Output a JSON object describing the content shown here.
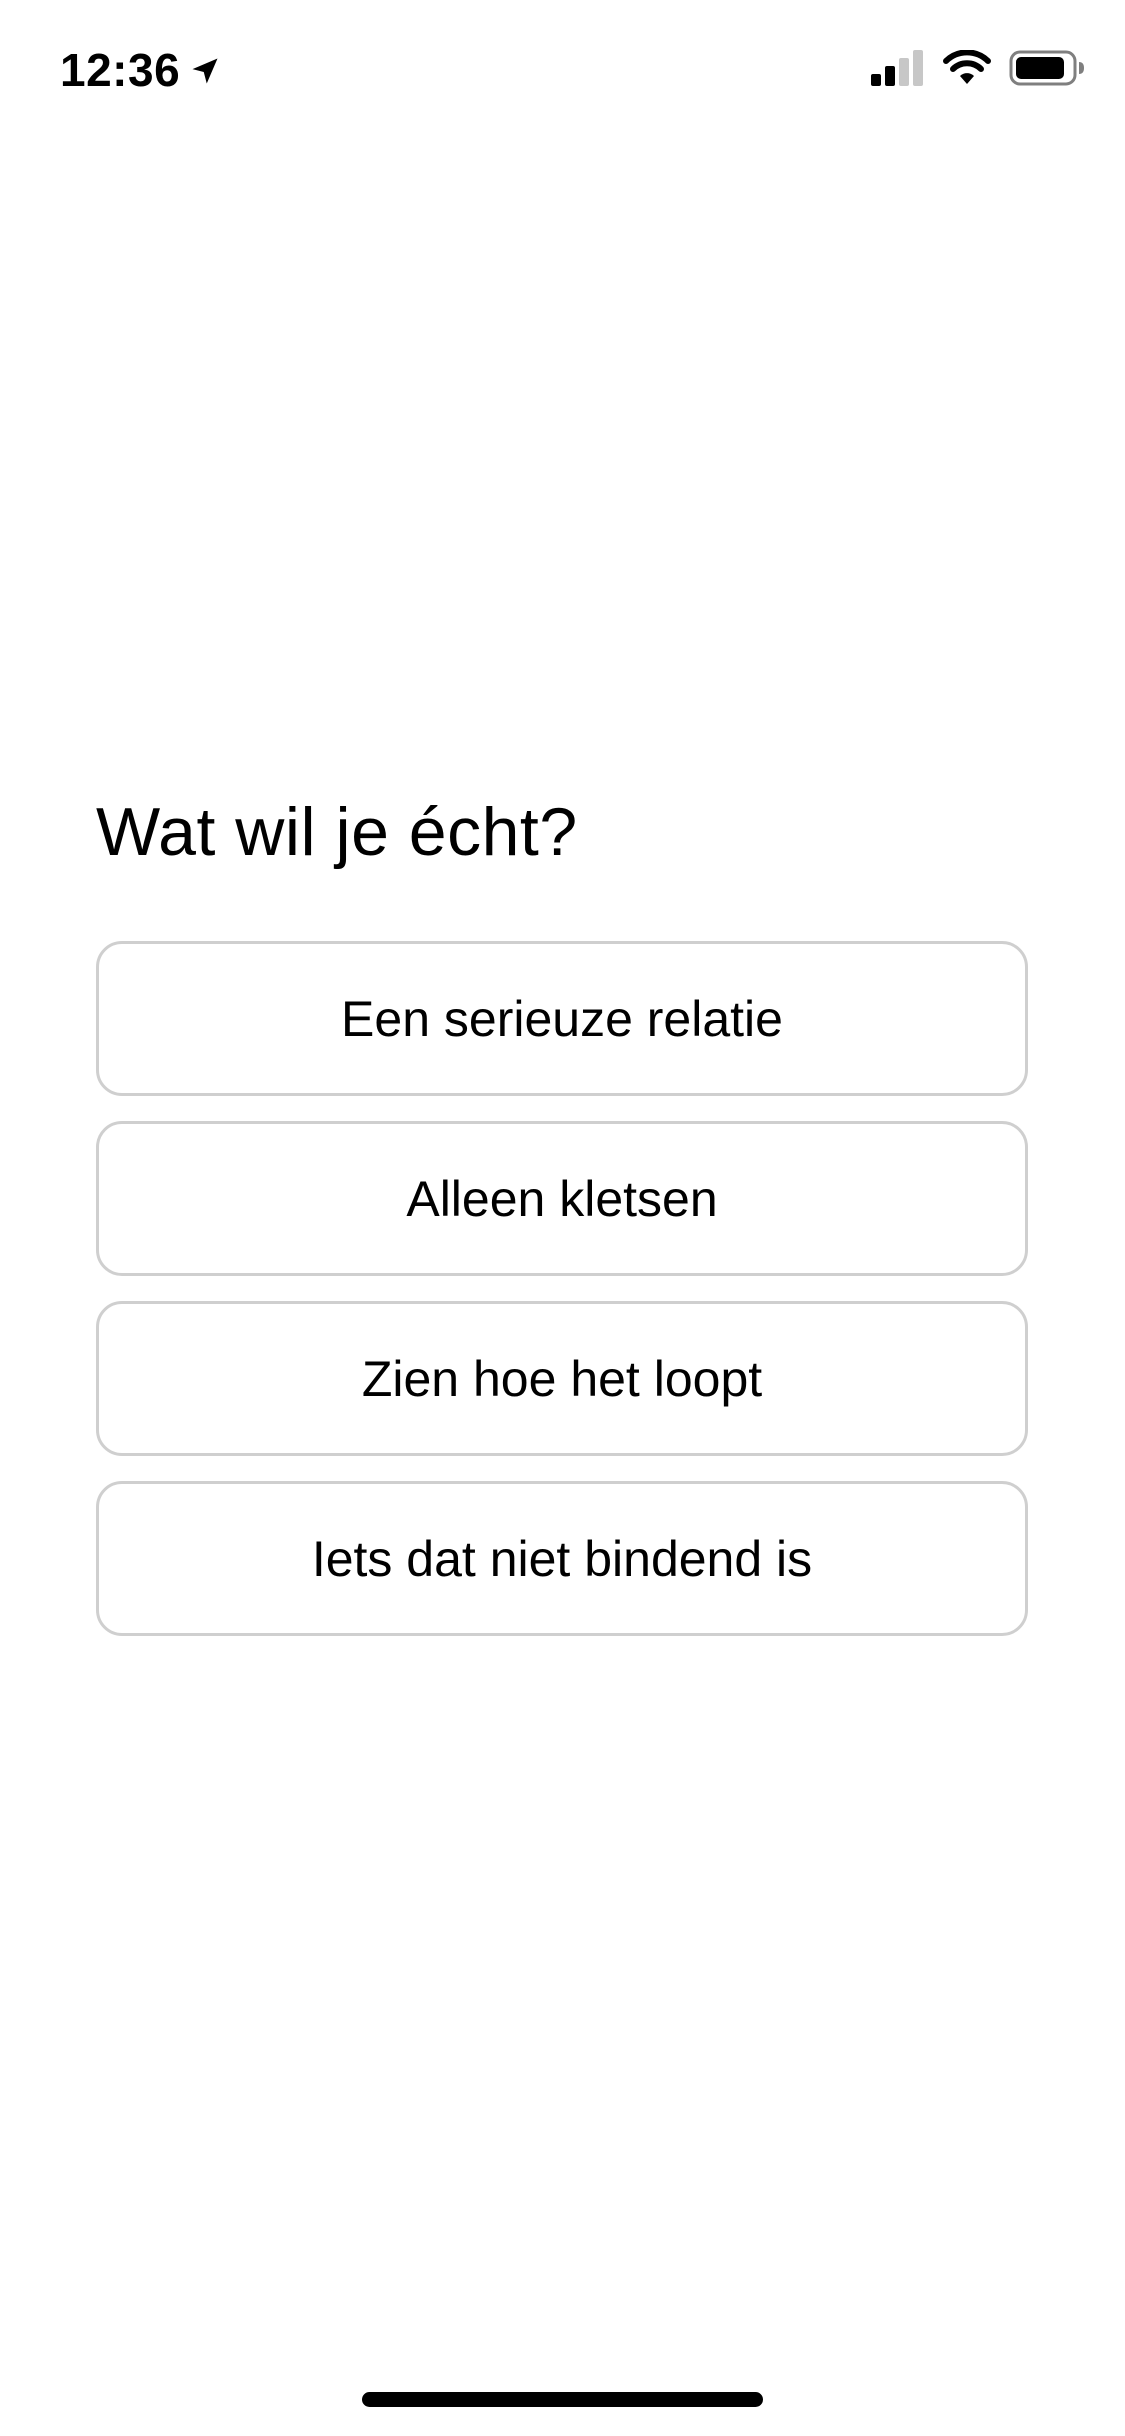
{
  "status_bar": {
    "time": "12:36",
    "icons": {
      "location": "location-arrow-icon",
      "cellular": "cellular-signal-icon",
      "wifi": "wifi-icon",
      "battery": "battery-icon"
    },
    "cellular_bars_active": 2,
    "cellular_bars_total": 4
  },
  "question": {
    "title": "Wat wil je écht?"
  },
  "options": [
    {
      "label": "Een serieuze relatie"
    },
    {
      "label": "Alleen kletsen"
    },
    {
      "label": "Zien hoe het loopt"
    },
    {
      "label": "Iets dat niet bindend is"
    }
  ],
  "colors": {
    "text": "#000000",
    "background": "#ffffff",
    "option_border": "#cfcfcf",
    "inactive_signal": "#c7c7c7"
  }
}
